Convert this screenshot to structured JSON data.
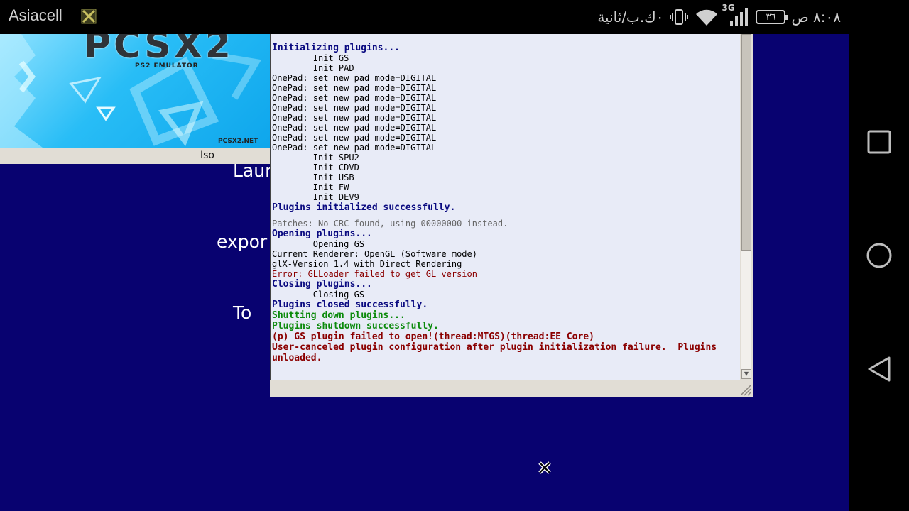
{
  "status_bar": {
    "carrier": "Asiacell",
    "time": "٨:٠٨ ص",
    "battery": "٣٦",
    "network_type": "3G",
    "data_rate": "٠ك.ب/ثانية",
    "icons": [
      "carrier-badge-icon",
      "data-rate-text",
      "vibrate-icon",
      "wifi-icon",
      "signal-icon",
      "battery-icon"
    ]
  },
  "banner": {
    "logo_text": "PCSX2",
    "subtitle": "PS2 EMULATOR",
    "site": "PCSX2.NET"
  },
  "iso_label": "Iso",
  "background_text": {
    "line1": "Laun",
    "line2": "expor",
    "line3": "To"
  },
  "console": {
    "lines": [
      {
        "text": "Initializing plugins...",
        "style": "head"
      },
      {
        "text": "        Init GS",
        "style": "normal"
      },
      {
        "text": "        Init PAD",
        "style": "normal"
      },
      {
        "text": "OnePad: set new pad mode=DIGITAL",
        "style": "normal"
      },
      {
        "text": "OnePad: set new pad mode=DIGITAL",
        "style": "normal"
      },
      {
        "text": "OnePad: set new pad mode=DIGITAL",
        "style": "normal"
      },
      {
        "text": "OnePad: set new pad mode=DIGITAL",
        "style": "normal"
      },
      {
        "text": "OnePad: set new pad mode=DIGITAL",
        "style": "normal"
      },
      {
        "text": "OnePad: set new pad mode=DIGITAL",
        "style": "normal"
      },
      {
        "text": "OnePad: set new pad mode=DIGITAL",
        "style": "normal"
      },
      {
        "text": "OnePad: set new pad mode=DIGITAL",
        "style": "normal"
      },
      {
        "text": "        Init SPU2",
        "style": "normal"
      },
      {
        "text": "        Init CDVD",
        "style": "normal"
      },
      {
        "text": "        Init USB",
        "style": "normal"
      },
      {
        "text": "        Init FW",
        "style": "normal"
      },
      {
        "text": "        Init DEV9",
        "style": "normal"
      },
      {
        "text": "Plugins initialized successfully.",
        "style": "head"
      },
      {
        "text": "",
        "style": "gap"
      },
      {
        "text": "Patches: No CRC found, using 00000000 instead.",
        "style": "gray"
      },
      {
        "text": "Opening plugins...",
        "style": "head"
      },
      {
        "text": "        Opening GS",
        "style": "normal"
      },
      {
        "text": "Current Renderer: OpenGL (Software mode)",
        "style": "normal"
      },
      {
        "text": "glX-Version 1.4 with Direct Rendering",
        "style": "normal"
      },
      {
        "text": "Error: GLLoader failed to get GL version",
        "style": "err"
      },
      {
        "text": "Closing plugins...",
        "style": "head"
      },
      {
        "text": "        Closing GS",
        "style": "normal"
      },
      {
        "text": "Plugins closed successfully.",
        "style": "head"
      },
      {
        "text": "Shutting down plugins...",
        "style": "green"
      },
      {
        "text": "Plugins shutdown successfully.",
        "style": "green"
      },
      {
        "text": "(p) GS plugin failed to open!(thread:MTGS)(thread:EE Core)",
        "style": "fatal"
      },
      {
        "text": "User-canceled plugin configuration after plugin initialization failure.  Plugins unloaded.",
        "style": "fatal"
      }
    ]
  },
  "nav_buttons": [
    "recent-apps-icon",
    "home-icon",
    "back-icon"
  ]
}
